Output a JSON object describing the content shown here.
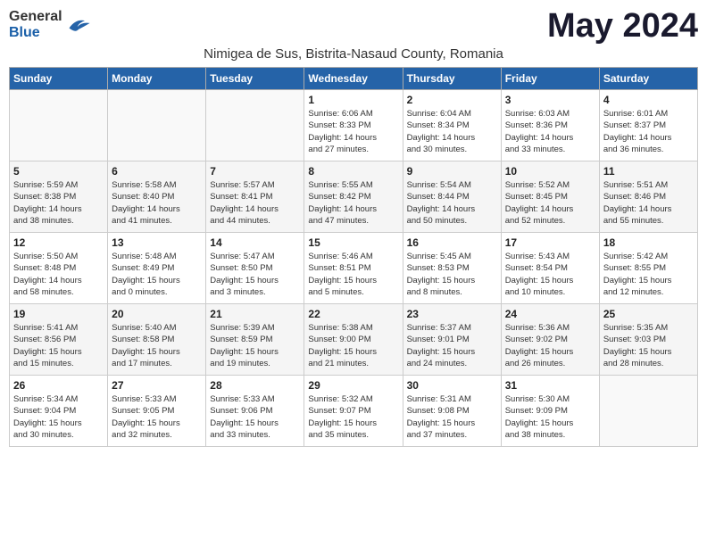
{
  "header": {
    "logo_general": "General",
    "logo_blue": "Blue",
    "month_title": "May 2024",
    "subtitle": "Nimigea de Sus, Bistrita-Nasaud County, Romania"
  },
  "weekdays": [
    "Sunday",
    "Monday",
    "Tuesday",
    "Wednesday",
    "Thursday",
    "Friday",
    "Saturday"
  ],
  "weeks": [
    [
      {
        "day": "",
        "info": ""
      },
      {
        "day": "",
        "info": ""
      },
      {
        "day": "",
        "info": ""
      },
      {
        "day": "1",
        "info": "Sunrise: 6:06 AM\nSunset: 8:33 PM\nDaylight: 14 hours\nand 27 minutes."
      },
      {
        "day": "2",
        "info": "Sunrise: 6:04 AM\nSunset: 8:34 PM\nDaylight: 14 hours\nand 30 minutes."
      },
      {
        "day": "3",
        "info": "Sunrise: 6:03 AM\nSunset: 8:36 PM\nDaylight: 14 hours\nand 33 minutes."
      },
      {
        "day": "4",
        "info": "Sunrise: 6:01 AM\nSunset: 8:37 PM\nDaylight: 14 hours\nand 36 minutes."
      }
    ],
    [
      {
        "day": "5",
        "info": "Sunrise: 5:59 AM\nSunset: 8:38 PM\nDaylight: 14 hours\nand 38 minutes."
      },
      {
        "day": "6",
        "info": "Sunrise: 5:58 AM\nSunset: 8:40 PM\nDaylight: 14 hours\nand 41 minutes."
      },
      {
        "day": "7",
        "info": "Sunrise: 5:57 AM\nSunset: 8:41 PM\nDaylight: 14 hours\nand 44 minutes."
      },
      {
        "day": "8",
        "info": "Sunrise: 5:55 AM\nSunset: 8:42 PM\nDaylight: 14 hours\nand 47 minutes."
      },
      {
        "day": "9",
        "info": "Sunrise: 5:54 AM\nSunset: 8:44 PM\nDaylight: 14 hours\nand 50 minutes."
      },
      {
        "day": "10",
        "info": "Sunrise: 5:52 AM\nSunset: 8:45 PM\nDaylight: 14 hours\nand 52 minutes."
      },
      {
        "day": "11",
        "info": "Sunrise: 5:51 AM\nSunset: 8:46 PM\nDaylight: 14 hours\nand 55 minutes."
      }
    ],
    [
      {
        "day": "12",
        "info": "Sunrise: 5:50 AM\nSunset: 8:48 PM\nDaylight: 14 hours\nand 58 minutes."
      },
      {
        "day": "13",
        "info": "Sunrise: 5:48 AM\nSunset: 8:49 PM\nDaylight: 15 hours\nand 0 minutes."
      },
      {
        "day": "14",
        "info": "Sunrise: 5:47 AM\nSunset: 8:50 PM\nDaylight: 15 hours\nand 3 minutes."
      },
      {
        "day": "15",
        "info": "Sunrise: 5:46 AM\nSunset: 8:51 PM\nDaylight: 15 hours\nand 5 minutes."
      },
      {
        "day": "16",
        "info": "Sunrise: 5:45 AM\nSunset: 8:53 PM\nDaylight: 15 hours\nand 8 minutes."
      },
      {
        "day": "17",
        "info": "Sunrise: 5:43 AM\nSunset: 8:54 PM\nDaylight: 15 hours\nand 10 minutes."
      },
      {
        "day": "18",
        "info": "Sunrise: 5:42 AM\nSunset: 8:55 PM\nDaylight: 15 hours\nand 12 minutes."
      }
    ],
    [
      {
        "day": "19",
        "info": "Sunrise: 5:41 AM\nSunset: 8:56 PM\nDaylight: 15 hours\nand 15 minutes."
      },
      {
        "day": "20",
        "info": "Sunrise: 5:40 AM\nSunset: 8:58 PM\nDaylight: 15 hours\nand 17 minutes."
      },
      {
        "day": "21",
        "info": "Sunrise: 5:39 AM\nSunset: 8:59 PM\nDaylight: 15 hours\nand 19 minutes."
      },
      {
        "day": "22",
        "info": "Sunrise: 5:38 AM\nSunset: 9:00 PM\nDaylight: 15 hours\nand 21 minutes."
      },
      {
        "day": "23",
        "info": "Sunrise: 5:37 AM\nSunset: 9:01 PM\nDaylight: 15 hours\nand 24 minutes."
      },
      {
        "day": "24",
        "info": "Sunrise: 5:36 AM\nSunset: 9:02 PM\nDaylight: 15 hours\nand 26 minutes."
      },
      {
        "day": "25",
        "info": "Sunrise: 5:35 AM\nSunset: 9:03 PM\nDaylight: 15 hours\nand 28 minutes."
      }
    ],
    [
      {
        "day": "26",
        "info": "Sunrise: 5:34 AM\nSunset: 9:04 PM\nDaylight: 15 hours\nand 30 minutes."
      },
      {
        "day": "27",
        "info": "Sunrise: 5:33 AM\nSunset: 9:05 PM\nDaylight: 15 hours\nand 32 minutes."
      },
      {
        "day": "28",
        "info": "Sunrise: 5:33 AM\nSunset: 9:06 PM\nDaylight: 15 hours\nand 33 minutes."
      },
      {
        "day": "29",
        "info": "Sunrise: 5:32 AM\nSunset: 9:07 PM\nDaylight: 15 hours\nand 35 minutes."
      },
      {
        "day": "30",
        "info": "Sunrise: 5:31 AM\nSunset: 9:08 PM\nDaylight: 15 hours\nand 37 minutes."
      },
      {
        "day": "31",
        "info": "Sunrise: 5:30 AM\nSunset: 9:09 PM\nDaylight: 15 hours\nand 38 minutes."
      },
      {
        "day": "",
        "info": ""
      }
    ]
  ]
}
